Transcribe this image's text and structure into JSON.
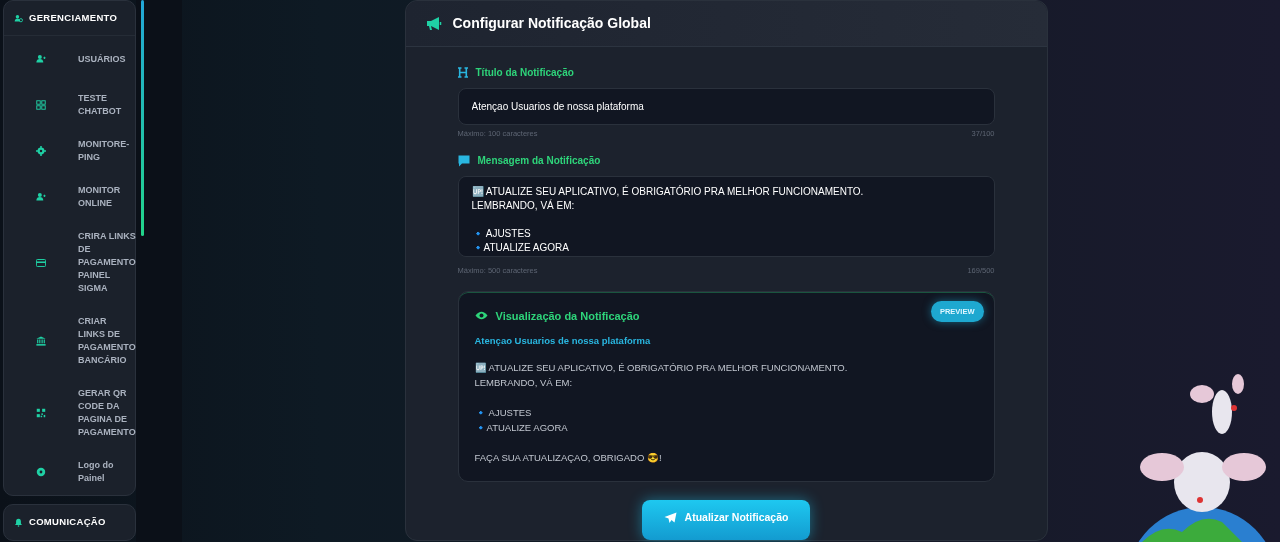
{
  "sidebar": {
    "sections": [
      {
        "title": "GERENCIAMENTO",
        "items": [
          {
            "label": "USUÁRIOS"
          },
          {
            "label": "TESTE CHATBOT"
          },
          {
            "label": "MONITORE-PING"
          },
          {
            "label": "MONITOR ONLINE"
          },
          {
            "label": "CRIRA LINKS DE PAGAMENTO PAINEL SIGMA"
          },
          {
            "label": "CRIAR LINKS DE PAGAMENTO BANCÁRIO"
          },
          {
            "label": "GERAR QR CODE DA PAGINA DE PAGAMENTO"
          },
          {
            "label": "Logo do Painel"
          }
        ]
      },
      {
        "title": "COMUNICAÇÃO"
      }
    ]
  },
  "card": {
    "title": "Configurar Notificação Global",
    "title_field": {
      "label": "Título da Notificação",
      "value": "Atençao Usuarios de nossa plataforma",
      "hint": "Máximo: 100 caracteres",
      "count": "37/100"
    },
    "message_field": {
      "label": "Mensagem da Notificação",
      "paragraphs": [
        [
          "🆙 ATUALIZE SEU APLICATIVO, É OBRIGATÓRIO PRA MELHOR FUNCIONAMENTO.",
          "LEMBRANDO, VÁ EM:"
        ],
        [
          "🔹 AJUSTES",
          "🔹ATUALIZE AGORA"
        ]
      ],
      "hint": "Máximo: 500 caracteres",
      "count": "169/500"
    },
    "preview": {
      "heading": "Visualização da Notificação",
      "badge": "PREVIEW",
      "title": "Atençao Usuarios de nossa plataforma",
      "paragraphs": [
        [
          "🆙 ATUALIZE SEU APLICATIVO, É OBRIGATÓRIO PRA MELHOR FUNCIONAMENTO.",
          "LEMBRANDO, VÁ EM:"
        ],
        [
          "🔹 AJUSTES",
          "🔹ATUALIZE AGORA"
        ],
        [
          "FAÇA SUA ATUALIZAÇAO, OBRIGADO 😎!"
        ]
      ]
    },
    "submit_button": "Atualizar Notificação"
  }
}
